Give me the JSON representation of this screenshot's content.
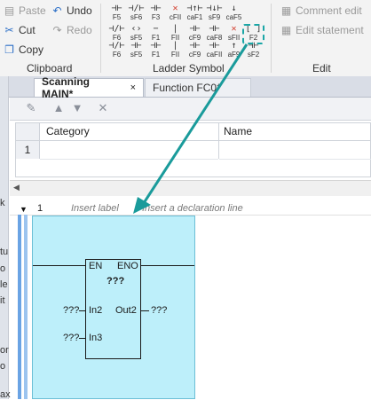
{
  "ribbon": {
    "clipboard": {
      "paste": "Paste",
      "undo": "Undo",
      "cut": "Cut",
      "redo": "Redo",
      "copy": "Copy",
      "group_label": "Clipboard"
    },
    "ladder": {
      "group_label": "Ladder Symbol",
      "row1": [
        {
          "sym": "⊣⊢",
          "key": "F5"
        },
        {
          "sym": "⊣/⊢",
          "key": "sF6"
        },
        {
          "sym": "⊣⊢",
          "key": "F3"
        },
        {
          "sym": "✕",
          "key": "cFII"
        },
        {
          "sym": "⊣↑⊢",
          "key": "caF1"
        },
        {
          "sym": "⊣↓⊢",
          "key": "sF9"
        },
        {
          "sym": "↓",
          "key": "caF5"
        }
      ],
      "row2": [
        {
          "sym": "⊣/⊢",
          "key": "F6"
        },
        {
          "sym": "‹›",
          "key": "sF5"
        },
        {
          "sym": "−",
          "key": "F1"
        },
        {
          "sym": "|",
          "key": "FII"
        },
        {
          "sym": "⊣⊢",
          "key": "cF9"
        },
        {
          "sym": "⊣⊢",
          "key": "caF8"
        },
        {
          "sym": "✕",
          "key": "sFII"
        },
        {
          "sym": "[ ]",
          "key": "F2"
        }
      ],
      "row3": [
        {
          "sym": "⊣/⊢",
          "key": "F6"
        },
        {
          "sym": "⊣⊢",
          "key": "sF5"
        },
        {
          "sym": "⊣⊢",
          "key": "F1"
        },
        {
          "sym": "|",
          "key": "FII"
        },
        {
          "sym": "⊣⊢",
          "key": "cF9"
        },
        {
          "sym": "⊣⊢",
          "key": "caFII"
        },
        {
          "sym": "↑",
          "key": "aF9"
        },
        {
          "sym": "⊣⊢",
          "key": "sF2"
        }
      ]
    },
    "edit": {
      "comment_edit": "Comment edit",
      "edit_statement": "Edit statement",
      "group_label": "Edit"
    }
  },
  "tabs": [
    {
      "label": "Scanning MAIN*",
      "close": "×",
      "active": true
    },
    {
      "label": "Function FC0*",
      "close": "",
      "active": false
    }
  ],
  "declaration": {
    "columns": [
      "Category",
      "Name"
    ],
    "rows": [
      {
        "num": "1",
        "category": "",
        "name": ""
      }
    ]
  },
  "ladder_editor": {
    "rung_number": "1",
    "insert_label": "Insert label",
    "insert_declaration": "Insert a declaration line",
    "block": {
      "en": "EN",
      "eno": "ENO",
      "name": "???",
      "in2": "In2",
      "out2": "Out2",
      "in3": "In3",
      "in2_value": "???",
      "out2_value": "???",
      "in3_value": "???"
    }
  },
  "left_truncated": [
    "k",
    "tu",
    "o",
    "le",
    "it",
    "or",
    "o",
    "ax"
  ],
  "colors": {
    "canvas": "#bdeffa",
    "arrow": "#1a9b9b",
    "highlight": "#1aa6a6"
  }
}
